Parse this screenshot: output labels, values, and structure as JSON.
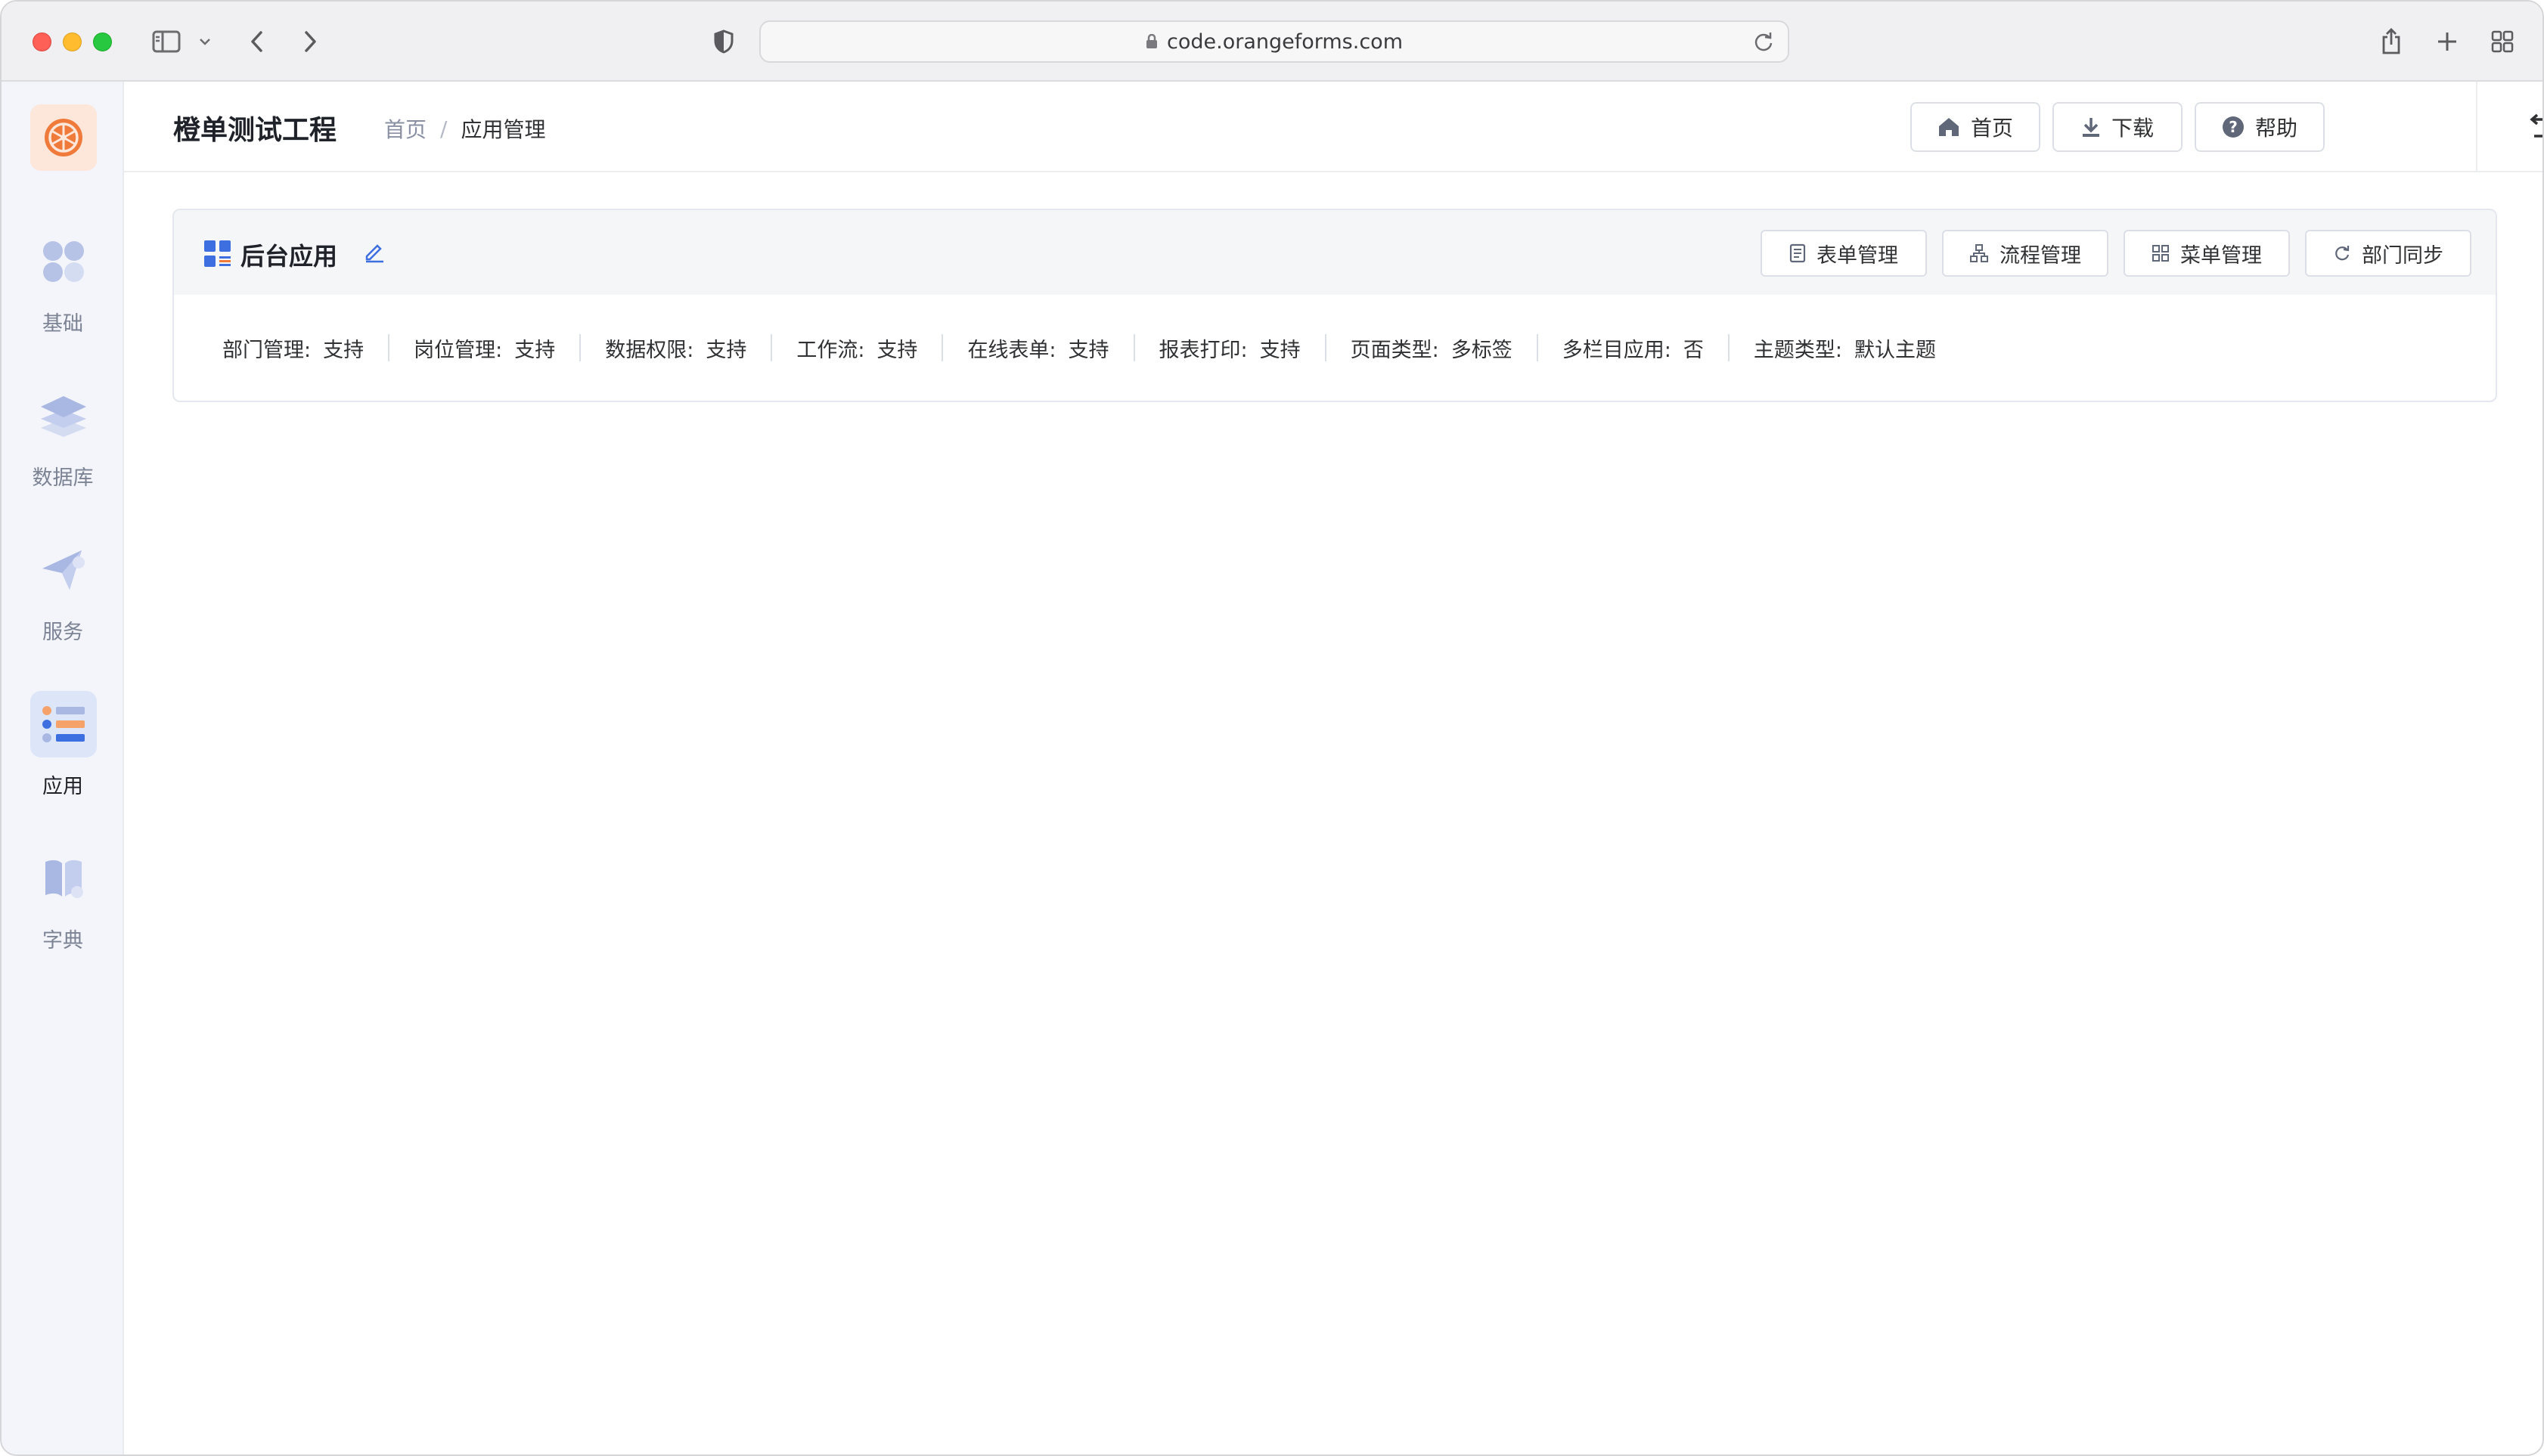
{
  "browser": {
    "url": "code.orangeforms.com"
  },
  "sidebar": {
    "items": [
      {
        "label": "基础",
        "icon": "grid-apps-icon",
        "active": false
      },
      {
        "label": "数据库",
        "icon": "layers-icon",
        "active": false
      },
      {
        "label": "服务",
        "icon": "paper-plane-icon",
        "active": false
      },
      {
        "label": "应用",
        "icon": "app-list-icon",
        "active": true
      },
      {
        "label": "字典",
        "icon": "book-icon",
        "active": false
      }
    ]
  },
  "header": {
    "project_title": "橙单测试工程",
    "breadcrumb": {
      "home": "首页",
      "separator": "/",
      "current": "应用管理"
    },
    "buttons": {
      "home": "首页",
      "download": "下载",
      "help": "帮助"
    },
    "back": "返回"
  },
  "card": {
    "title": "后台应用",
    "buttons": {
      "form_manage": "表单管理",
      "flow_manage": "流程管理",
      "menu_manage": "菜单管理",
      "dept_sync": "部门同步"
    },
    "properties": [
      {
        "key": "部门管理:",
        "value": "支持"
      },
      {
        "key": "岗位管理:",
        "value": "支持"
      },
      {
        "key": "数据权限:",
        "value": "支持"
      },
      {
        "key": "工作流:",
        "value": "支持"
      },
      {
        "key": "在线表单:",
        "value": "支持"
      },
      {
        "key": "报表打印:",
        "value": "支持"
      },
      {
        "key": "页面类型:",
        "value": "多标签"
      },
      {
        "key": "多栏目应用:",
        "value": "否"
      },
      {
        "key": "主题类型:",
        "value": "默认主题"
      }
    ]
  },
  "colors": {
    "accent": "#3e6fe0",
    "brand_orange": "#f07a3a",
    "sidebar_bg": "#f3f5fa",
    "active_bg": "#dde5f8"
  }
}
